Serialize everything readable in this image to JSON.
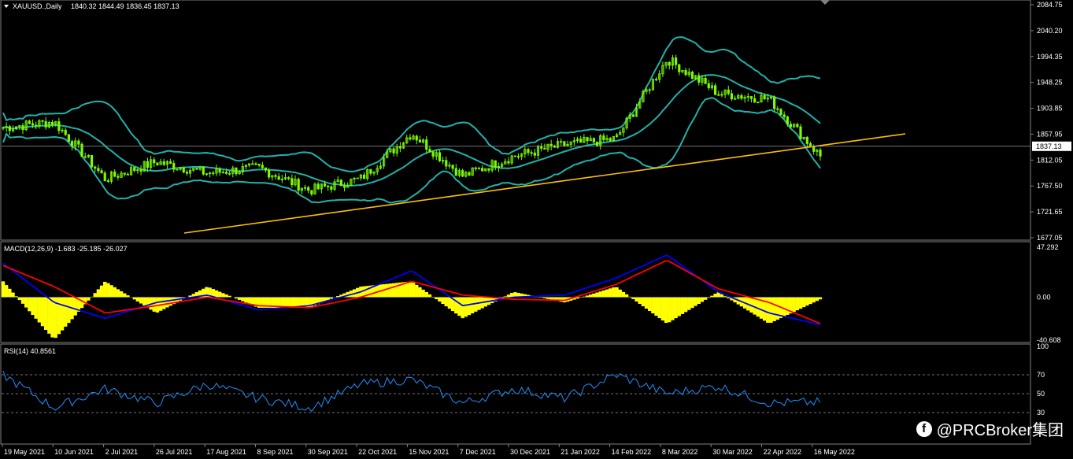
{
  "header": {
    "symbol": "XAUUSD.,Daily",
    "ohlc": "1840.32 1844.49 1836.45 1837.13"
  },
  "price_panel": {
    "current_price_label": "1837.13",
    "y_ticks": [
      "2084.75",
      "2040.20",
      "1994.35",
      "1948.25",
      "1903.85",
      "1857.95",
      "1812.05",
      "1767.50",
      "1721.65",
      "1677.05"
    ]
  },
  "macd_panel": {
    "title": "MACD(12,26,9) -1.683 -25.185 -26.027",
    "y_ticks": [
      "47.292",
      "0.00",
      "-40.608"
    ]
  },
  "rsi_panel": {
    "title": "RSI(14) 40.8561",
    "y_ticks": [
      "100",
      "70",
      "50",
      "30"
    ]
  },
  "x_axis": {
    "labels": [
      "19 May 2021",
      "10 Jun 2021",
      "2 Jul 2021",
      "26 Jul 2021",
      "17 Aug 2021",
      "8 Sep 2021",
      "30 Sep 2021",
      "22 Oct 2021",
      "15 Nov 2021",
      "7 Dec 2021",
      "30 Dec 2021",
      "21 Jan 2022",
      "14 Feb 2022",
      "8 Mar 2022",
      "30 Mar 2022",
      "22 Apr 2022",
      "16 May 2022"
    ]
  },
  "watermark": {
    "text": "@PRCBroker集团",
    "icon": "facebook-icon"
  },
  "colors": {
    "candle": "#7CFC00",
    "bollinger": "#20B2AA",
    "trendline": "#FFC000",
    "macd_hist": "#FFFF00",
    "macd_line": "#0000FF",
    "signal_line": "#FF0000",
    "rsi_line": "#1E90FF"
  },
  "chart_data": [
    {
      "type": "line",
      "title": "XAUUSD.,Daily",
      "x": [
        "19 May 2021",
        "10 Jun 2021",
        "2 Jul 2021",
        "26 Jul 2021",
        "17 Aug 2021",
        "8 Sep 2021",
        "30 Sep 2021",
        "22 Oct 2021",
        "15 Nov 2021",
        "7 Dec 2021",
        "30 Dec 2021",
        "21 Jan 2022",
        "14 Feb 2022",
        "8 Mar 2022",
        "30 Mar 2022",
        "22 Apr 2022",
        "16 May 2022"
      ],
      "series": [
        {
          "values": [
            1870,
            1880,
            1780,
            1810,
            1790,
            1800,
            1760,
            1780,
            1860,
            1785,
            1820,
            1840,
            1850,
            1990,
            1930,
            1920,
            1820
          ]
        }
      ],
      "ylim": [
        1677.05,
        2084.75
      ]
    },
    {
      "type": "bar",
      "title": "MACD(12,26,9) -1.683 -25.185 -26.027",
      "x": [
        "19 May 2021",
        "10 Jun 2021",
        "2 Jul 2021",
        "26 Jul 2021",
        "17 Aug 2021",
        "8 Sep 2021",
        "30 Sep 2021",
        "22 Oct 2021",
        "15 Nov 2021",
        "7 Dec 2021",
        "30 Dec 2021",
        "21 Jan 2022",
        "14 Feb 2022",
        "8 Mar 2022",
        "30 Mar 2022",
        "22 Apr 2022",
        "16 May 2022"
      ],
      "series": [
        {
          "values": [
            15,
            -40,
            15,
            -15,
            10,
            -10,
            -10,
            10,
            15,
            -20,
            5,
            -5,
            10,
            -25,
            5,
            -25,
            -2
          ]
        },
        {
          "values": [
            32,
            -5,
            -20,
            -5,
            2,
            -12,
            -8,
            5,
            25,
            -8,
            0,
            2,
            18,
            40,
            5,
            -15,
            -26
          ]
        },
        {
          "values": [
            30,
            10,
            -15,
            -8,
            0,
            -8,
            -10,
            0,
            15,
            2,
            -2,
            -3,
            12,
            35,
            8,
            -5,
            -25
          ]
        }
      ],
      "ylim": [
        -40.608,
        47.292
      ]
    },
    {
      "type": "line",
      "title": "RSI(14) 40.8561",
      "x": [
        "19 May 2021",
        "10 Jun 2021",
        "2 Jul 2021",
        "26 Jul 2021",
        "17 Aug 2021",
        "8 Sep 2021",
        "30 Sep 2021",
        "22 Oct 2021",
        "15 Nov 2021",
        "7 Dec 2021",
        "30 Dec 2021",
        "21 Jan 2022",
        "14 Feb 2022",
        "8 Mar 2022",
        "30 Mar 2022",
        "22 Apr 2022",
        "16 May 2022"
      ],
      "series": [
        {
          "values": [
            70,
            35,
            55,
            40,
            60,
            45,
            35,
            60,
            65,
            40,
            55,
            45,
            70,
            50,
            58,
            40,
            40.8561
          ]
        }
      ],
      "ylim": [
        0,
        100
      ]
    }
  ]
}
